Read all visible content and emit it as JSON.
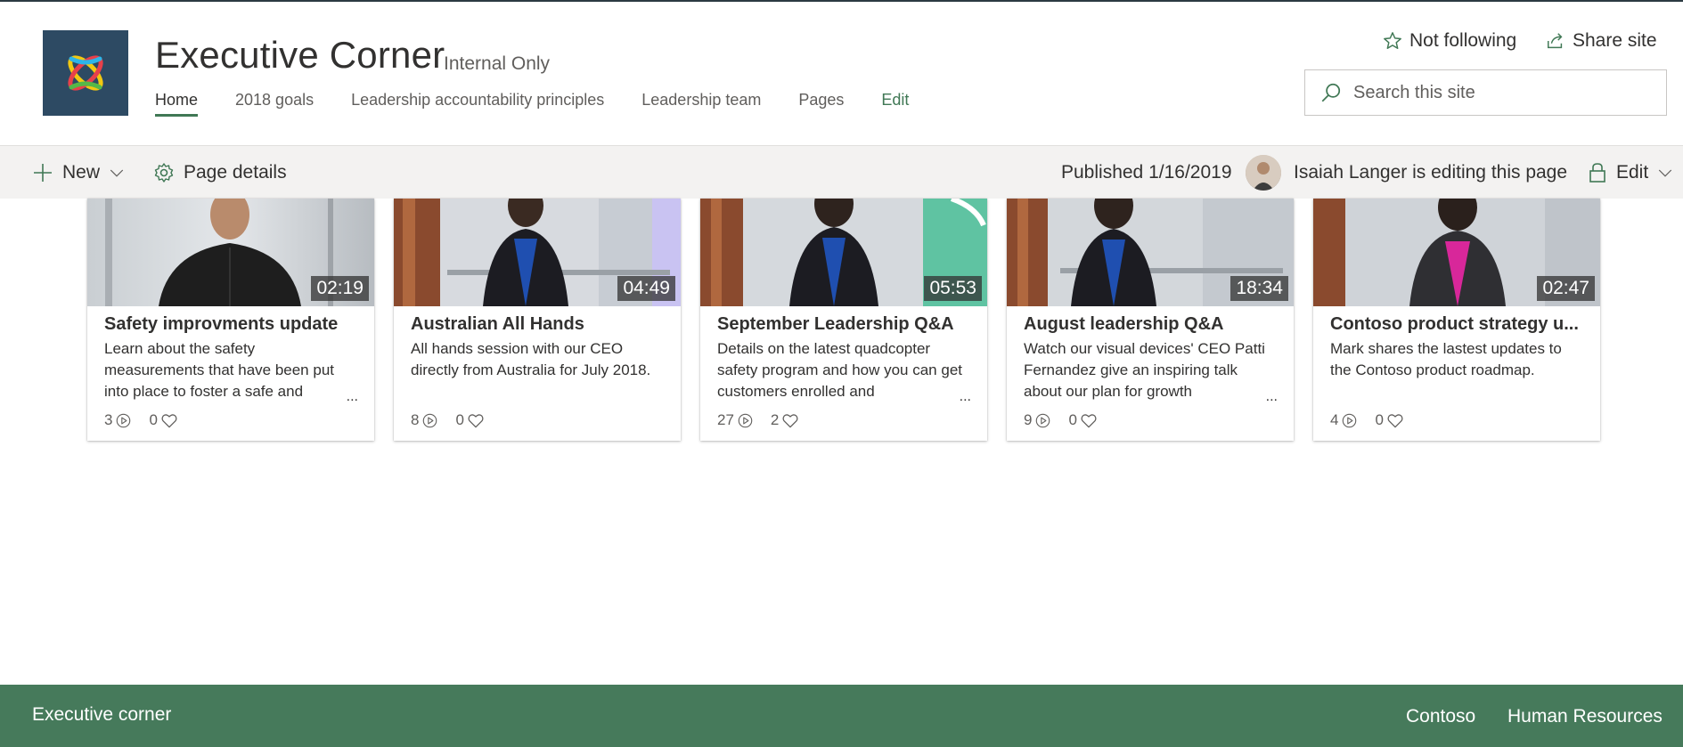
{
  "header": {
    "site_title": "Executive Corner",
    "site_classification": "Internal Only",
    "logo_icon": "contoso-logo-icon",
    "nav": [
      {
        "label": "Home",
        "active": true
      },
      {
        "label": "2018 goals"
      },
      {
        "label": "Leadership accountability principles"
      },
      {
        "label": "Leadership team"
      },
      {
        "label": "Pages"
      },
      {
        "label": "Edit"
      }
    ],
    "follow_label": "Not following",
    "share_label": "Share site",
    "search_placeholder": "Search this site"
  },
  "command_bar": {
    "new_label": "New",
    "page_details_label": "Page details",
    "published_label": "Published 1/16/2019",
    "editing_label": "Isaiah Langer is editing this page",
    "edit_label": "Edit"
  },
  "cards": [
    {
      "title": "Safety improvments update",
      "description": "Learn about the safety measurements that have been put into place to foster a safe and",
      "duration": "02:19",
      "views": "3",
      "likes": "0",
      "show_more": true
    },
    {
      "title": "Australian All Hands",
      "description": "All hands session with our CEO directly from Australia for July 2018.",
      "duration": "04:49",
      "views": "8",
      "likes": "0",
      "show_more": false
    },
    {
      "title": "September Leadership Q&A",
      "description": "Details on the latest quadcopter safety program and how you can get customers enrolled and",
      "duration": "05:53",
      "views": "27",
      "likes": "2",
      "show_more": true
    },
    {
      "title": "August leadership Q&A",
      "description": "Watch our visual devices' CEO Patti Fernandez give an inspiring talk about our plan for growth",
      "duration": "18:34",
      "views": "9",
      "likes": "0",
      "show_more": true
    },
    {
      "title": "Contoso product strategy u...",
      "description": "Mark shares the lastest updates to the Contoso product roadmap.",
      "duration": "02:47",
      "views": "4",
      "likes": "0",
      "show_more": false
    }
  ],
  "more_glyph": "...",
  "footer": {
    "title": "Executive corner",
    "links": [
      "Contoso",
      "Human Resources"
    ]
  },
  "colors": {
    "accent": "#407855",
    "footer_bg": "#467a5b",
    "command_bar_bg": "#f3f2f1",
    "logo_bg": "#2d4a63"
  }
}
